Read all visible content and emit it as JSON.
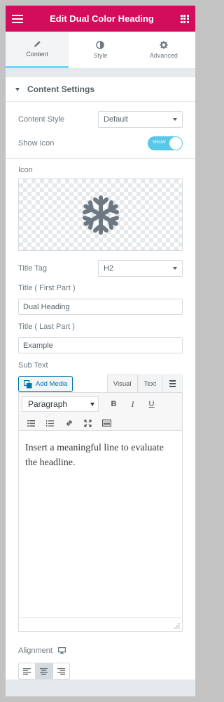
{
  "header": {
    "title": "Edit Dual Color Heading",
    "menu_icon": "hamburger-icon",
    "apps_icon": "grid-icon"
  },
  "tabs": [
    {
      "label": "Content",
      "icon": "pencil-icon",
      "active": true
    },
    {
      "label": "Style",
      "icon": "contrast-icon",
      "active": false
    },
    {
      "label": "Advanced",
      "icon": "gear-icon",
      "active": false
    }
  ],
  "section": {
    "title": "Content Settings"
  },
  "fields": {
    "content_style": {
      "label": "Content Style",
      "value": "Default"
    },
    "show_icon": {
      "label": "Show Icon",
      "toggle_text": "SHOW",
      "on": true
    },
    "icon": {
      "label": "Icon",
      "glyph": "snowflake-icon"
    },
    "title_tag": {
      "label": "Title Tag",
      "value": "H2"
    },
    "title_first": {
      "label": "Title ( First Part )",
      "value": "Dual Heading"
    },
    "title_last": {
      "label": "Title ( Last Part )",
      "value": "Example"
    },
    "sub_text": {
      "label": "Sub Text"
    }
  },
  "editor": {
    "add_media": "Add Media",
    "tab_visual": "Visual",
    "tab_text": "Text",
    "format": "Paragraph",
    "bold": "B",
    "italic": "I",
    "underline": "U",
    "content": "Insert a meaningful line to evaluate the headline."
  },
  "alignment": {
    "label": "Alignment",
    "selected": "center"
  },
  "colors": {
    "brand": "#d30c5c",
    "toggle": "#58c8e8",
    "link": "#0073aa"
  }
}
